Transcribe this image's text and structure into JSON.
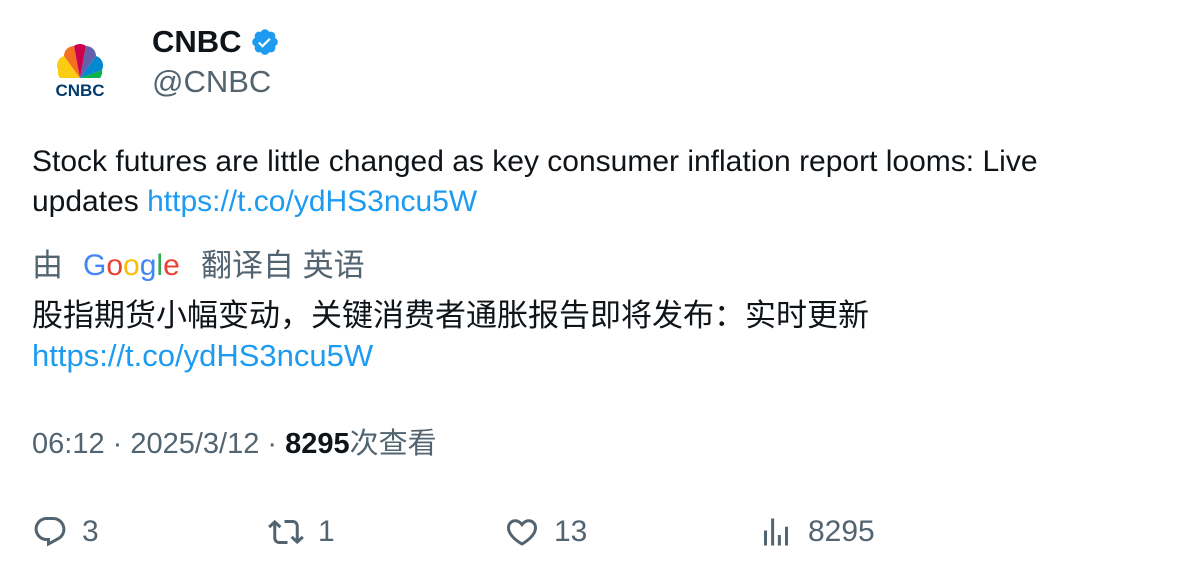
{
  "author": {
    "display_name": "CNBC",
    "handle": "@CNBC",
    "logo_text": "CNBC",
    "avatar_icon": "peacock-logo",
    "verified_icon": "verified-badge-icon",
    "verified_color": "#1d9bf0"
  },
  "tweet": {
    "text": "Stock futures are little changed as key consumer inflation report looms: Live updates ",
    "link": "https://t.co/ydHS3ncu5W"
  },
  "translation": {
    "prefix": "由",
    "provider_logo_text": "Google",
    "suffix": "翻译自 英语",
    "text": "股指期货小幅变动，关键消费者通胀报告即将发布：实时更新",
    "link": "https://t.co/ydHS3ncu5W"
  },
  "meta": {
    "time": "06:12",
    "separator": " · ",
    "date": "2025/3/12",
    "views": "8295",
    "views_label": "次查看"
  },
  "actions": {
    "replies": "3",
    "retweets": "1",
    "likes": "13",
    "views": "8295"
  },
  "colors": {
    "link": "#1d9bf0",
    "secondary_text": "#536471",
    "primary_text": "#0f1419"
  }
}
